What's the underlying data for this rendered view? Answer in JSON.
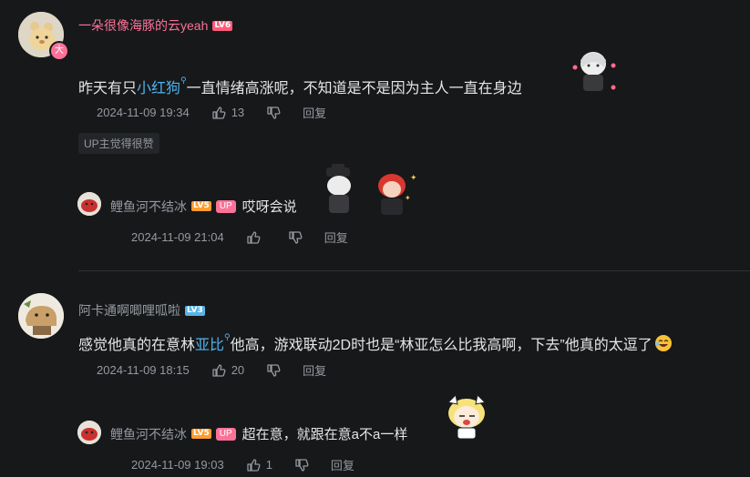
{
  "comments": [
    {
      "username": "一朵很像海豚的云yeah",
      "level": "LV6",
      "avatar_badge": "大",
      "content_before": "昨天有只",
      "content_link": "小红狗",
      "content_after": "一直情绪高涨呢，不知道是不是因为主人一直在身边",
      "time": "2024-11-09 19:34",
      "likes": "13",
      "reply_label": "回复",
      "tag": "UP主觉得很赞",
      "reply": {
        "username": "鲤鱼河不结冰",
        "level": "LV5",
        "up_badge": "UP",
        "content": "哎呀会说",
        "time": "2024-11-09 21:04",
        "reply_label": "回复"
      }
    },
    {
      "username": "阿卡通啊唧哩呱啦",
      "level": "LV3",
      "content_before": "感觉他真的在意林",
      "content_link": "亚比",
      "content_after": "他高，游戏联动2D时也是“林亚怎么比我高啊，下去”他真的太逗了",
      "time": "2024-11-09 18:15",
      "likes": "20",
      "reply_label": "回复",
      "reply": {
        "username": "鲤鱼河不结冰",
        "level": "LV5",
        "up_badge": "UP",
        "content": "超在意，就跟在意a不a一样",
        "time": "2024-11-09 19:03",
        "likes": "1",
        "reply_label": "回复"
      }
    }
  ],
  "icons": {
    "like": "thumb-up-icon",
    "dislike": "thumb-down-icon",
    "search_mark": "search-icon"
  },
  "colors": {
    "background": "#17181a",
    "username_pink": "#fb7299",
    "link_blue": "#4fb3ee",
    "meta_gray": "#9499a0",
    "lv6": "#ff5c7c",
    "lv5": "#ff9d2f",
    "lv3": "#5ab4e6"
  }
}
